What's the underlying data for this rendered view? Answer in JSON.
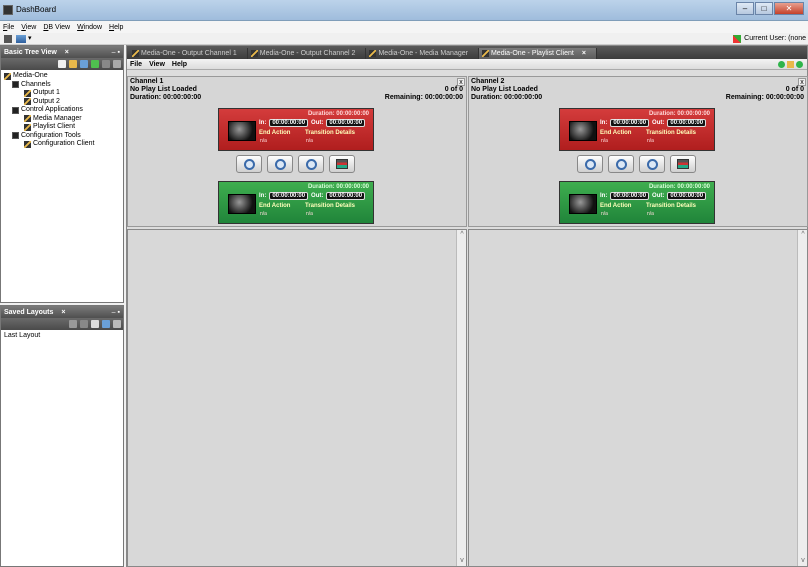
{
  "window": {
    "title": "DashBoard",
    "controls": [
      "–",
      "□",
      "✕"
    ]
  },
  "menubar": [
    "File",
    "View",
    "DB View",
    "Window",
    "Help"
  ],
  "user": {
    "label": "Current User: (none"
  },
  "tree_panel": {
    "title": "Basic Tree View",
    "close": "×",
    "items": [
      {
        "label": "Media-One",
        "level": 0,
        "icon": "media-one-icon"
      },
      {
        "label": "Channels",
        "level": 1,
        "icon": "folder-icon"
      },
      {
        "label": "Output 1",
        "level": 2,
        "icon": "media-one-icon"
      },
      {
        "label": "Output 2",
        "level": 2,
        "icon": "media-one-icon"
      },
      {
        "label": "Control Applications",
        "level": 1,
        "icon": "folder-icon"
      },
      {
        "label": "Media Manager",
        "level": 2,
        "icon": "media-one-icon"
      },
      {
        "label": "Playlist Client",
        "level": 2,
        "icon": "media-one-icon"
      },
      {
        "label": "Configuration Tools",
        "level": 1,
        "icon": "folder-icon"
      },
      {
        "label": "Configuration Client",
        "level": 2,
        "icon": "media-one-icon"
      }
    ]
  },
  "layouts_panel": {
    "title": "Saved Layouts",
    "close": "×",
    "items": [
      "Last Layout"
    ]
  },
  "tabs": [
    {
      "label": "Media-One - Output Channel 1",
      "active": false
    },
    {
      "label": "Media-One - Output Channel 2",
      "active": false
    },
    {
      "label": "Media-One - Media Manager",
      "active": false
    },
    {
      "label": "Media-One - Playlist Client",
      "active": true,
      "close": "×"
    }
  ],
  "submenu": [
    "File",
    "View",
    "Help"
  ],
  "status_colors": [
    "#2fb44a",
    "#f0c000",
    "#2fb44a"
  ],
  "channels": [
    {
      "title": "Channel 1",
      "status": "No Play List Loaded",
      "count": "0 of 0",
      "duration": "Duration: 00:00:00:00",
      "remaining": "Remaining: 00:00:00:00",
      "current": {
        "duration": "Duration: 00:00:00:00",
        "in_label": "In:",
        "in": "00:00:00:00",
        "out_label": "Out:",
        "out": "00:00:00:00",
        "end_action": "End Action",
        "transition": "Transition Details",
        "na1": "n/a",
        "na2": "n/a"
      },
      "next": {
        "duration": "Duration: 00:00:00:00",
        "in_label": "In:",
        "in": "00:00:00:00",
        "out_label": "Out:",
        "out": "00:00:00:00",
        "end_action": "End Action",
        "transition": "Transition Details",
        "na1": "n/a",
        "na2": "n/a"
      }
    },
    {
      "title": "Channel 2",
      "status": "No Play List Loaded",
      "count": "0 of 0",
      "duration": "Duration: 00:00:00:00",
      "remaining": "Remaining: 00:00:00:00",
      "current": {
        "duration": "Duration: 00:00:00:00",
        "in_label": "In:",
        "in": "00:00:00:00",
        "out_label": "Out:",
        "out": "00:00:00:00",
        "end_action": "End Action",
        "transition": "Transition Details",
        "na1": "n/a",
        "na2": "n/a"
      },
      "next": {
        "duration": "Duration: 00:00:00:00",
        "in_label": "In:",
        "in": "00:00:00:00",
        "out_label": "Out:",
        "out": "00:00:00:00",
        "end_action": "End Action",
        "transition": "Transition Details",
        "na1": "n/a",
        "na2": "n/a"
      }
    }
  ]
}
